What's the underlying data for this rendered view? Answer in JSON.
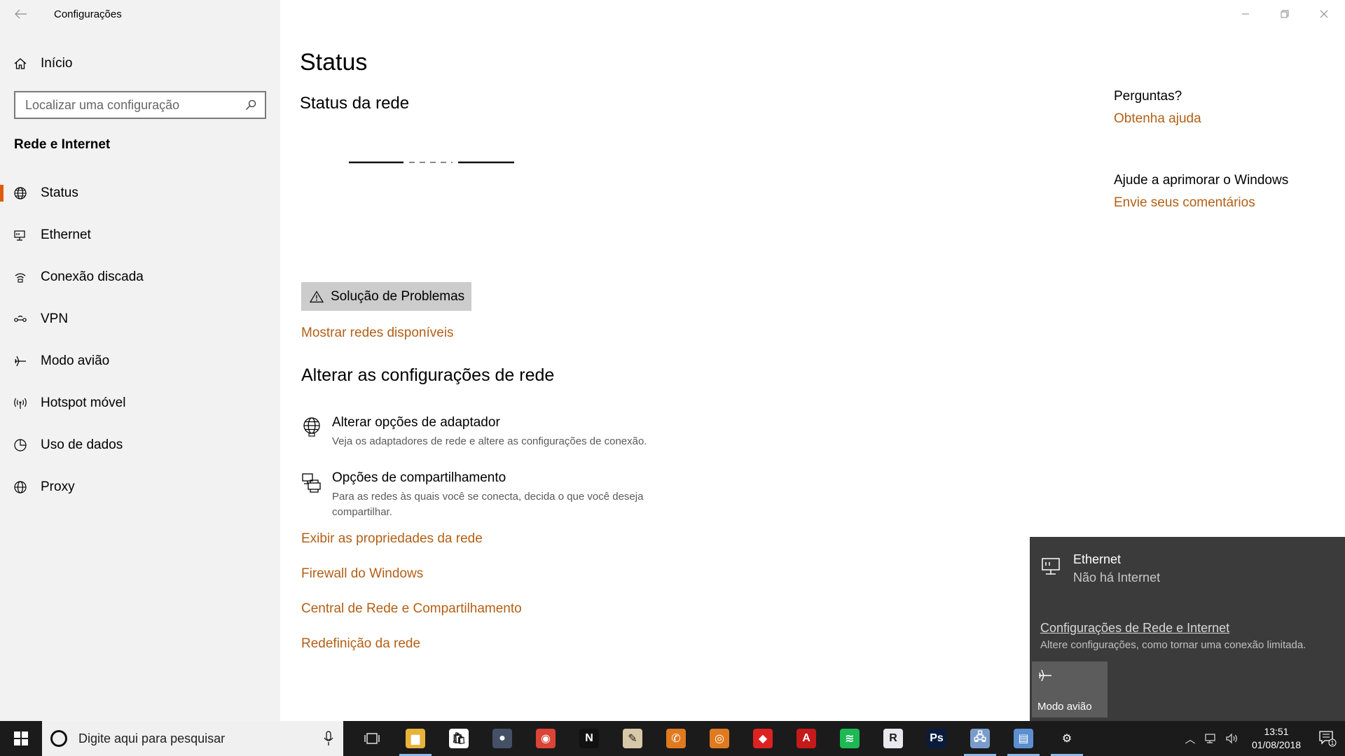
{
  "window": {
    "title": "Configurações"
  },
  "sidebar": {
    "home_label": "Início",
    "search_placeholder": "Localizar uma configuração",
    "section_title": "Rede e Internet",
    "items": [
      {
        "label": "Status",
        "icon": "globe-icon",
        "active": true
      },
      {
        "label": "Ethernet",
        "icon": "ethernet-icon"
      },
      {
        "label": "Conexão discada",
        "icon": "dialup-icon"
      },
      {
        "label": "VPN",
        "icon": "vpn-icon"
      },
      {
        "label": "Modo avião",
        "icon": "airplane-icon"
      },
      {
        "label": "Hotspot móvel",
        "icon": "hotspot-icon"
      },
      {
        "label": "Uso de dados",
        "icon": "data-usage-icon"
      },
      {
        "label": "Proxy",
        "icon": "globe-icon"
      }
    ]
  },
  "main": {
    "title": "Status",
    "network_status_title": "Status da rede",
    "troubleshoot_label": "Solução de Problemas",
    "show_networks_link": "Mostrar redes disponíveis",
    "change_settings_title": "Alterar as configurações de rede",
    "options": [
      {
        "title": "Alterar opções de adaptador",
        "desc": "Veja os adaptadores de rede e altere as configurações de conexão."
      },
      {
        "title": "Opções de compartilhamento",
        "desc": "Para as redes às quais você se conecta, decida o que você deseja compartilhar."
      }
    ],
    "links": [
      "Exibir as propriedades da rede",
      "Firewall do Windows",
      "Central de Rede e Compartilhamento",
      "Redefinição da rede"
    ]
  },
  "right": {
    "questions_title": "Perguntas?",
    "help_link": "Obtenha ajuda",
    "improve_title": "Ajude a aprimorar o Windows",
    "feedback_link": "Envie seus comentários"
  },
  "flyout": {
    "network_name": "Ethernet",
    "network_status": "Não há Internet",
    "settings_link": "Configurações de Rede e Internet",
    "settings_desc": "Altere configurações, como tornar uma conexão limitada.",
    "airplane_tile": "Modo avião"
  },
  "taskbar": {
    "search_placeholder": "Digite aqui para pesquisar",
    "time": "13:51",
    "date": "01/08/2018",
    "notification_count": "1",
    "apps": [
      {
        "name": "file-explorer-icon",
        "color": "#e8b33a",
        "glyph": "▆"
      },
      {
        "name": "store-icon",
        "color": "#ffffff",
        "glyph": "🛍"
      },
      {
        "name": "globe-app-icon",
        "color": "#445066",
        "glyph": "●"
      },
      {
        "name": "chrome-icon",
        "color": "#db4437",
        "glyph": "◉"
      },
      {
        "name": "netflix-icon",
        "color": "#111111",
        "glyph": "N"
      },
      {
        "name": "paint-icon",
        "color": "#d8c8a8",
        "glyph": "✎"
      },
      {
        "name": "whatsapp-icon",
        "color": "#e07a20",
        "glyph": "✆"
      },
      {
        "name": "instagram-icon",
        "color": "#e07a20",
        "glyph": "◎"
      },
      {
        "name": "sketchup-icon",
        "color": "#d22",
        "glyph": "◆"
      },
      {
        "name": "autocad-icon",
        "color": "#c41a1a",
        "glyph": "A"
      },
      {
        "name": "spotify-icon",
        "color": "#1db954",
        "glyph": "≋"
      },
      {
        "name": "revit-icon",
        "color": "#e8e8ee",
        "glyph": "R"
      },
      {
        "name": "photoshop-icon",
        "color": "#0a1c3d",
        "glyph": "Ps"
      },
      {
        "name": "network-app-icon",
        "color": "#7a9ccc",
        "glyph": "🖧"
      },
      {
        "name": "control-panel-icon",
        "color": "#5b8fd1",
        "glyph": "▤"
      },
      {
        "name": "settings-app-icon",
        "color": "#1b1b1b",
        "glyph": "⚙"
      }
    ]
  }
}
